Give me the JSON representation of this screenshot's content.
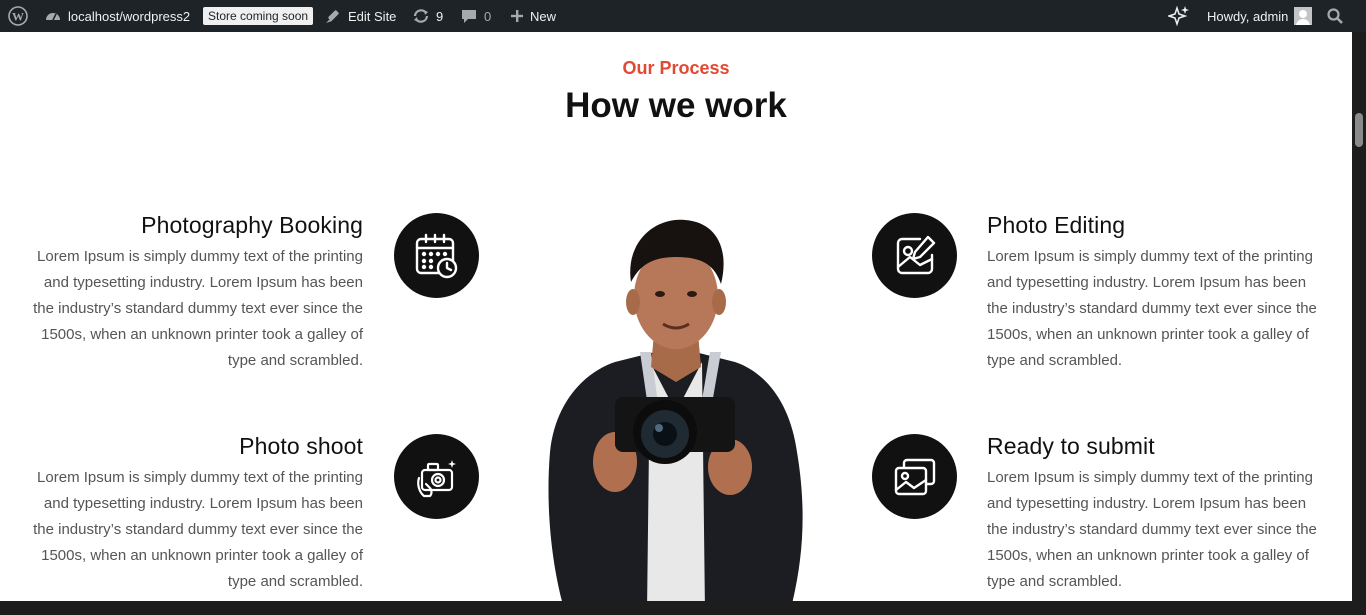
{
  "adminbar": {
    "site_name": "localhost/wordpress2",
    "store_badge": "Store coming soon",
    "edit_site": "Edit Site",
    "updates_count": "9",
    "comments_count": "0",
    "new_label": "New",
    "howdy": "Howdy, admin",
    "icons": [
      "wordpress-logo-icon",
      "dashboard-icon",
      "brush-icon",
      "updates-icon",
      "comment-icon",
      "plus-icon",
      "sparkle-icon",
      "search-icon"
    ]
  },
  "section": {
    "eyebrow": "Our Process",
    "heading": "How we work",
    "accent_color": "#e04a32"
  },
  "steps": [
    {
      "title": "Photography Booking",
      "text": "Lorem Ipsum is simply dummy text of the printing and typesetting industry. Lorem Ipsum has been the industry’s standard dummy text ever since the 1500s, when an unknown printer took a galley of type and scrambled.",
      "icon": "calendar-clock-icon"
    },
    {
      "title": "Photo shoot",
      "text": "Lorem Ipsum is simply dummy text of the printing and typesetting industry. Lorem Ipsum has been the industry’s standard dummy text ever since the 1500s, when an unknown printer took a galley of type and scrambled.",
      "icon": "camera-hand-icon"
    },
    {
      "title": "Photo Editing",
      "text": "Lorem Ipsum is simply dummy text of the printing and typesetting industry. Lorem Ipsum has been the industry’s standard dummy text ever since the 1500s, when an unknown printer took a galley of type and scrambled.",
      "icon": "image-edit-icon"
    },
    {
      "title": "Ready to submit",
      "text": "Lorem Ipsum is simply dummy text of the printing and typesetting industry. Lorem Ipsum has been the industry’s standard dummy text ever since the 1500s, when an unknown printer took a galley of type and scrambled.",
      "icon": "photos-stack-icon"
    }
  ]
}
